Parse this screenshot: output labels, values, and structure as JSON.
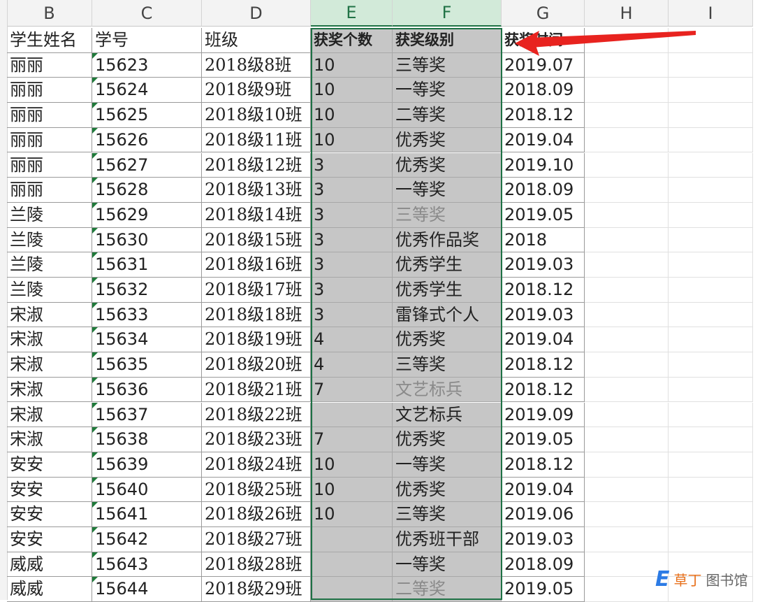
{
  "columns": [
    "B",
    "C",
    "D",
    "E",
    "F",
    "G",
    "H",
    "I"
  ],
  "selected_columns": [
    "E",
    "F"
  ],
  "headers": [
    "学生姓名",
    "学号",
    "班级",
    "获奖个数",
    "获奖级别",
    "获奖时间"
  ],
  "rows": [
    {
      "name": "丽丽",
      "id": "15623",
      "cls": "2018级8班",
      "count": "10",
      "level": "三等奖",
      "date": "2019.07"
    },
    {
      "name": "丽丽",
      "id": "15624",
      "cls": "2018级9班",
      "count": "10",
      "level": "一等奖",
      "date": "2018.09"
    },
    {
      "name": "丽丽",
      "id": "15625",
      "cls": "2018级10班",
      "count": "10",
      "level": "二等奖",
      "date": "2018.12"
    },
    {
      "name": "丽丽",
      "id": "15626",
      "cls": "2018级11班",
      "count": "10",
      "level": "优秀奖",
      "date": "2019.04"
    },
    {
      "name": "丽丽",
      "id": "15627",
      "cls": "2018级12班",
      "count": "3",
      "level": "优秀奖",
      "date": "2019.10"
    },
    {
      "name": "丽丽",
      "id": "15628",
      "cls": "2018级13班",
      "count": "3",
      "level": "一等奖",
      "date": "2018.09"
    },
    {
      "name": "兰陵",
      "id": "15629",
      "cls": "2018级14班",
      "count": "3",
      "level": "三等奖",
      "date": "2019.05"
    },
    {
      "name": "兰陵",
      "id": "15630",
      "cls": "2018级15班",
      "count": "3",
      "level": "优秀作品奖",
      "date": "2018"
    },
    {
      "name": "兰陵",
      "id": "15631",
      "cls": "2018级16班",
      "count": "3",
      "level": "优秀学生",
      "date": "2019.03"
    },
    {
      "name": "兰陵",
      "id": "15632",
      "cls": "2018级17班",
      "count": "3",
      "level": "优秀学生",
      "date": "2018.12"
    },
    {
      "name": "宋淑",
      "id": "15633",
      "cls": "2018级18班",
      "count": "3",
      "level": "雷锋式个人",
      "date": "2019.03"
    },
    {
      "name": "宋淑",
      "id": "15634",
      "cls": "2018级19班",
      "count": "4",
      "level": "优秀奖",
      "date": "2019.04"
    },
    {
      "name": "宋淑",
      "id": "15635",
      "cls": "2018级20班",
      "count": "4",
      "level": "三等奖",
      "date": "2018.12"
    },
    {
      "name": "宋淑",
      "id": "15636",
      "cls": "2018级21班",
      "count": "7",
      "level": "文艺标兵",
      "date": "2018.12"
    },
    {
      "name": "宋淑",
      "id": "15637",
      "cls": "2018级22班",
      "count": "",
      "level": "文艺标兵",
      "date": "2019.09"
    },
    {
      "name": "宋淑",
      "id": "15638",
      "cls": "2018级23班",
      "count": "7",
      "level": "优秀奖",
      "date": "2019.05"
    },
    {
      "name": "安安",
      "id": "15639",
      "cls": "2018级24班",
      "count": "10",
      "level": "一等奖",
      "date": "2018.12"
    },
    {
      "name": "安安",
      "id": "15640",
      "cls": "2018级25班",
      "count": "10",
      "level": "优秀奖",
      "date": "2019.04"
    },
    {
      "name": "安安",
      "id": "15641",
      "cls": "2018级26班",
      "count": "10",
      "level": "三等奖",
      "date": "2019.06"
    },
    {
      "name": "安安",
      "id": "15642",
      "cls": "2018级27班",
      "count": "",
      "level": "优秀班干部",
      "date": "2019.03"
    },
    {
      "name": "威威",
      "id": "15643",
      "cls": "2018级28班",
      "count": "",
      "level": "一等奖",
      "date": "2018.09"
    },
    {
      "name": "威威",
      "id": "15644",
      "cls": "2018级29班",
      "count": "",
      "level": "二等奖",
      "date": "2019.05"
    }
  ],
  "watermark": {
    "logo": "E",
    "text_orange": "草丁",
    "text_gray": "图书馆"
  },
  "colors": {
    "selection": "#1e7145",
    "arrow": "#e8231f",
    "selected_fill": "#c6c6c6"
  }
}
